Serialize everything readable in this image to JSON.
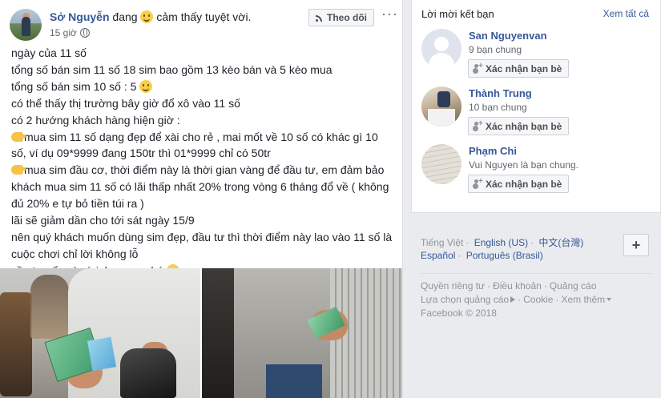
{
  "post": {
    "author": "Sở Nguyễn",
    "feeling_prefix": "đang",
    "feeling_text": "cảm thấy tuyệt vời.",
    "time": "15 giờ",
    "follow_label": "Theo dõi",
    "more_label": "···",
    "body_lines": [
      {
        "icon": "",
        "text": "ngày của 11 số"
      },
      {
        "icon": "",
        "text": "tổng số bán sim 11 số 18 sim bao gồm 13 kèo bán và 5 kèo mua"
      },
      {
        "icon": "",
        "text": "tổng số bán sim 10 số : 5",
        "emoji": "smile"
      },
      {
        "icon": "",
        "text": "có thể thấy thị trường bây giờ đổ xô vào 11 số"
      },
      {
        "icon": "",
        "text": "có 2 hướng khách hàng hiện giờ :"
      },
      {
        "icon": "hand",
        "text": "mua sim 11 số dạng đẹp để xài cho rẻ , mai mốt về 10 số có khác gì 10"
      },
      {
        "icon": "",
        "text": "số, ví dụ 09*9999 đang 150tr thì 01*9999 chỉ có 50tr"
      },
      {
        "icon": "hand",
        "text": "mua sim đầu cơ, thời điểm này là thời gian vàng để đầu tư, em đảm bảo"
      },
      {
        "icon": "",
        "text": "khách mua sim 11 số có lãi thấp nhất 20% trong vòng 6 tháng đổ về ( không"
      },
      {
        "icon": "",
        "text": "đủ 20% e tự bỏ tiền túi ra )"
      },
      {
        "icon": "",
        "text": "lãi sẽ giảm dần cho tới sát ngày 15/9"
      },
      {
        "icon": "",
        "text": "nên quý khách muốn dùng sim đẹp, đầu tư thì thời điểm này lao vào 11 số là"
      },
      {
        "icon": "",
        "text": "cuộc chơi chỉ lời không lỗ"
      },
      {
        "icon": "",
        "text": "cần tư vấn gì cứ inbox em nhé",
        "emoji": "tongue"
      }
    ]
  },
  "friend_requests": {
    "title": "Lời mời kết bạn",
    "see_all": "Xem tất cả",
    "confirm_label": "Xác nhận bạn bè",
    "items": [
      {
        "name": "San Nguyenvan",
        "sub": "9 bạn chung"
      },
      {
        "name": "Thành Trung",
        "sub": "10 bạn chung"
      },
      {
        "name": "Phạm Chi",
        "sub": "Vui Nguyen là bạn chung."
      }
    ]
  },
  "languages": {
    "current": "Tiếng Việt",
    "options": [
      "English (US)",
      "中文(台灣)",
      "Español",
      "Português (Brasil)"
    ],
    "add_label": "+"
  },
  "footer": {
    "privacy": "Quyền riêng tư",
    "terms": "Điều khoản",
    "ads": "Quảng cáo",
    "ad_choices": "Lựa chọn quảng cáo",
    "cookie": "Cookie",
    "more": "Xem thêm",
    "copyright": "Facebook © 2018"
  }
}
